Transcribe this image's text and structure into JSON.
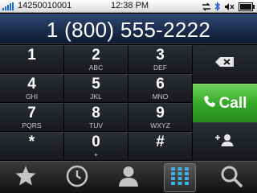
{
  "status_bar": {
    "carrier_text": "14250010001",
    "time": "12:38 PM"
  },
  "dialer": {
    "number": "1 (800) 555-2222",
    "keys": [
      {
        "digit": "1",
        "letters": ""
      },
      {
        "digit": "2",
        "letters": "ABC"
      },
      {
        "digit": "3",
        "letters": "DEF"
      },
      {
        "digit": "4",
        "letters": "GHI"
      },
      {
        "digit": "5",
        "letters": "JKL"
      },
      {
        "digit": "6",
        "letters": "MNO"
      },
      {
        "digit": "7",
        "letters": "PQRS"
      },
      {
        "digit": "8",
        "letters": "TUV"
      },
      {
        "digit": "9",
        "letters": "WXYZ"
      },
      {
        "digit": "*",
        "letters": ""
      },
      {
        "digit": "0",
        "letters": "+"
      },
      {
        "digit": "#",
        "letters": ""
      }
    ],
    "call_label": "Call"
  },
  "tabs": [
    "favorites-star-icon",
    "call-log-clock-icon",
    "contacts-person-icon",
    "dialpad-grid-icon",
    "search-icon"
  ],
  "colors": {
    "call_green": "#35a92a",
    "display_blue": "#1a2d4d",
    "status_bg": "#ffffff"
  }
}
